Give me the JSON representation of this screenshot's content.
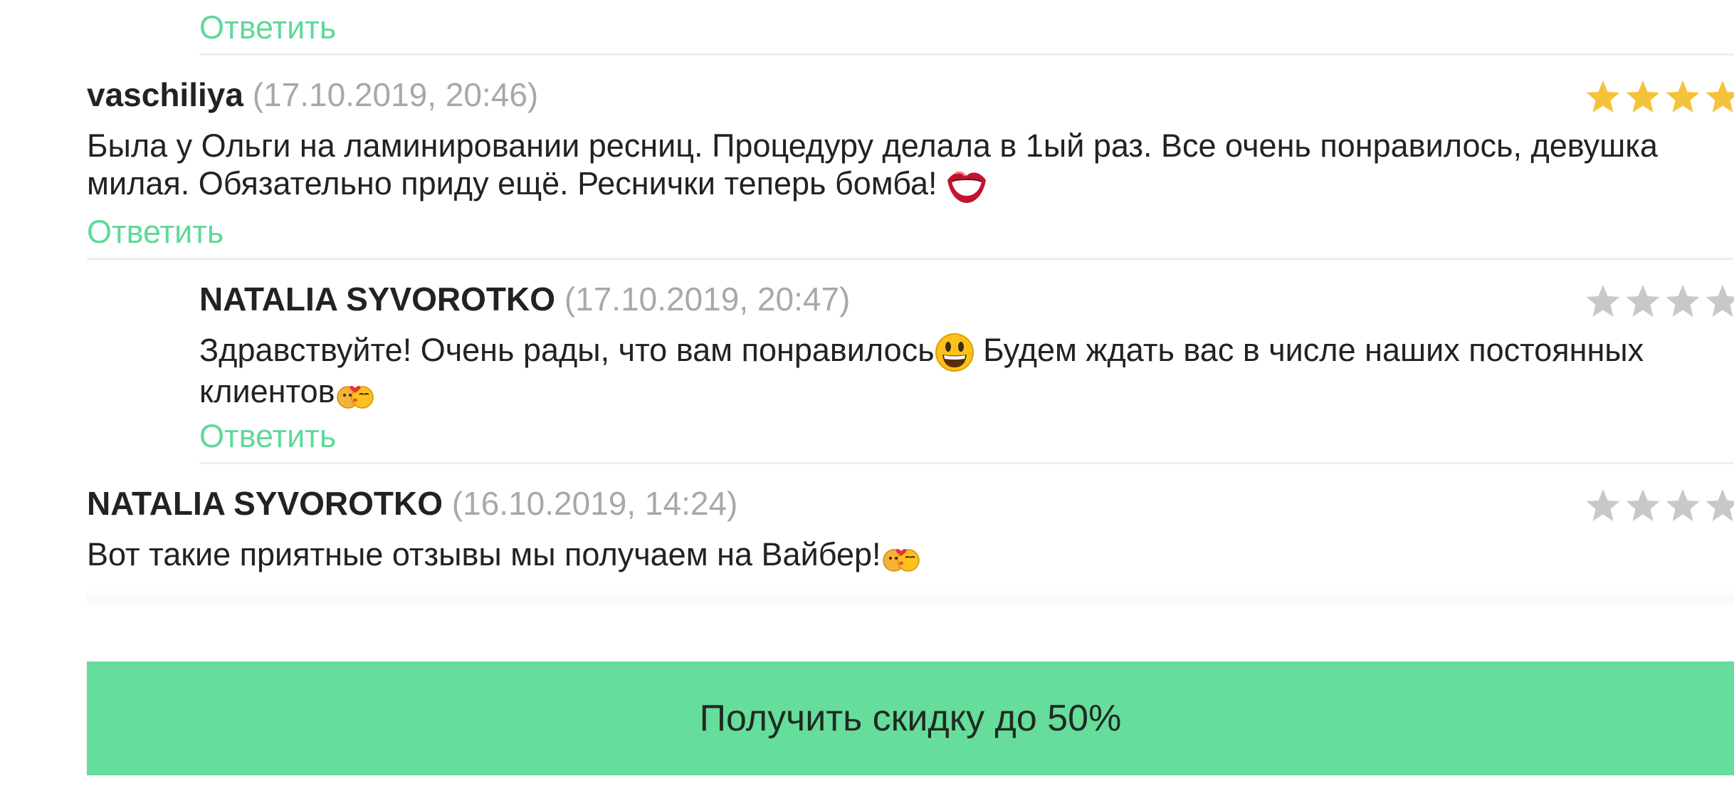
{
  "reply_label": "Ответить",
  "colors": {
    "accent": "#5fd99a",
    "cta_bg": "#66dd9a",
    "star_filled": "#f5c33b",
    "star_empty": "#c8c8c8",
    "date_text": "#a8a8a8"
  },
  "comments": [
    {
      "author": "vaschiliya",
      "date": "(17.10.2019, 20:46)",
      "text": "Была у Ольги на ламинировании ресниц. Процедуру делала в 1ый раз. Все очень понравилось, девушка милая. Обязательно приду ещё. Реснички теперь бомба!",
      "emoji": "lips-icon",
      "rating_filled": true
    },
    {
      "author": "NATALIA SYVOROTKO",
      "date": "(17.10.2019, 20:47)",
      "text_part1": "Здравствуйте! Очень рады, что вам понравилось",
      "text_part2": " Будем ждать вас в числе наших постоянных клиентов",
      "emoji1": "smiling-face-icon",
      "emoji2": "kissing-couple-icon",
      "rating_filled": false
    },
    {
      "author": "NATALIA SYVOROTKO",
      "date": "(16.10.2019, 14:24)",
      "text": "Вот такие приятные отзывы мы получаем на Вайбер!",
      "emoji": "kissing-couple-icon",
      "rating_filled": false
    }
  ],
  "cta_label": "Получить скидку до 50%"
}
